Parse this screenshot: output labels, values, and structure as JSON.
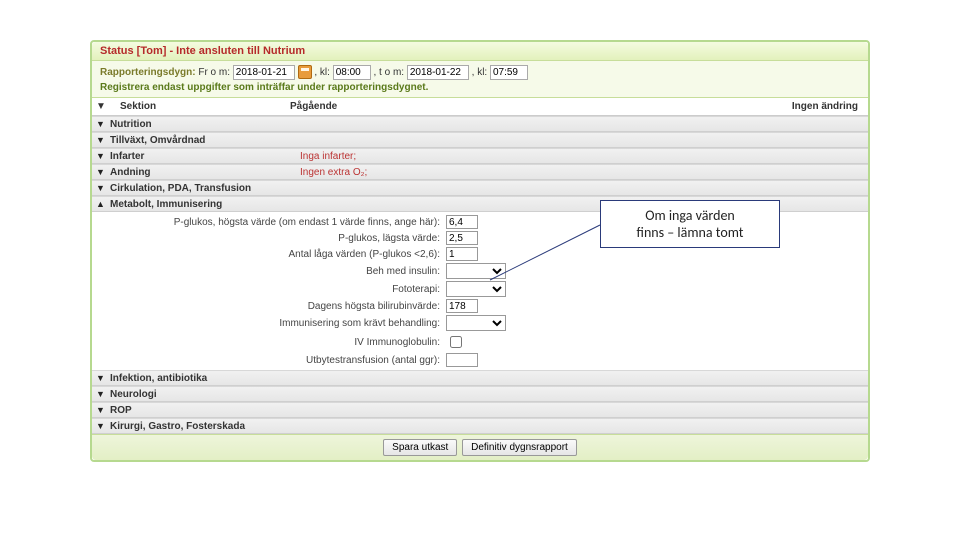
{
  "status": "Status [Tom] - Inte ansluten till Nutrium",
  "period": {
    "label": "Rapporteringsdygn:",
    "from_lbl": "Fr o m:",
    "from_date": "2018-01-21",
    "kl": "kl:",
    "from_time": "08:00",
    "to_lbl": "t o m:",
    "to_date": "2018-01-22",
    "to_time": "07:59"
  },
  "note": "Registrera endast uppgifter som inträffar under rapporteringsdygnet.",
  "columns": {
    "section": "Sektion",
    "ongoing": "Pågående",
    "nochange": "Ingen ändring"
  },
  "sections": [
    {
      "title": "Nutrition",
      "expanded": false,
      "status": ""
    },
    {
      "title": "Tillväxt, Omvårdnad",
      "expanded": false,
      "status": ""
    },
    {
      "title": "Infarter",
      "expanded": false,
      "status": "Inga infarter;"
    },
    {
      "title": "Andning",
      "expanded": false,
      "status": "Ingen extra O₂;"
    },
    {
      "title": "Cirkulation, PDA, Transfusion",
      "expanded": false,
      "status": ""
    },
    {
      "title": "Metabolt, Immunisering",
      "expanded": true,
      "status": ""
    },
    {
      "title": "Infektion, antibiotika",
      "expanded": false,
      "status": ""
    },
    {
      "title": "Neurologi",
      "expanded": false,
      "status": ""
    },
    {
      "title": "ROP",
      "expanded": false,
      "status": ""
    },
    {
      "title": "Kirurgi, Gastro, Fosterskada",
      "expanded": false,
      "status": ""
    }
  ],
  "metabolt": {
    "f0": {
      "label": "P-glukos, högsta värde (om endast 1 värde finns, ange här):",
      "value": "6,4"
    },
    "f1": {
      "label": "P-glukos, lägsta värde:",
      "value": "2,5"
    },
    "f2": {
      "label": "Antal låga värden (P-glukos <2,6):",
      "value": "1"
    },
    "f3": {
      "label": "Beh med insulin:",
      "value": ""
    },
    "f4": {
      "label": "Fototerapi:",
      "value": ""
    },
    "f5": {
      "label": "Dagens högsta bilirubinvärde:",
      "value": "178"
    },
    "f6": {
      "label": "Immunisering som krävt behandling:",
      "value": ""
    },
    "f7": {
      "label": "IV Immunoglobulin:",
      "value": ""
    },
    "f8": {
      "label": "Utbytestransfusion (antal ggr):",
      "value": ""
    }
  },
  "footer": {
    "draft": "Spara utkast",
    "final": "Definitiv dygnsrapport"
  },
  "callout": {
    "line1": "Om inga värden",
    "line2": "finns – lämna tomt"
  }
}
